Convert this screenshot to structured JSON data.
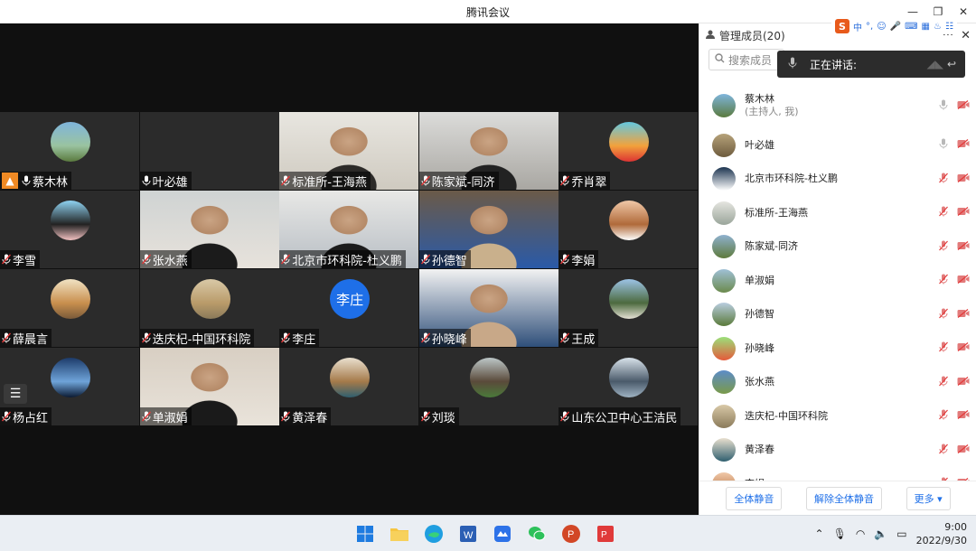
{
  "window": {
    "title": "腾讯会议"
  },
  "ime": {
    "logo": "S",
    "mode": "中"
  },
  "tiles": [
    {
      "name": "蔡木林",
      "host": true,
      "muted": false,
      "kind": "avatar",
      "palette": [
        "#7fb5dc",
        "#9ac3a0",
        "#5a7a3e"
      ]
    },
    {
      "name": "叶必雄",
      "muted": false,
      "kind": "blank"
    },
    {
      "name": "标准所-王海燕",
      "muted": true,
      "kind": "video",
      "palette": [
        "#e8e6e0",
        "#cfcac0",
        "#2c2a28"
      ]
    },
    {
      "name": "陈家斌-同济",
      "muted": true,
      "kind": "video",
      "palette": [
        "#dcdcda",
        "#a9a7a2",
        "#222"
      ]
    },
    {
      "name": "乔肖翠",
      "muted": true,
      "kind": "avatar",
      "palette": [
        "#63c8e0",
        "#f2a23c",
        "#d33"
      ]
    },
    {
      "name": "李雪",
      "muted": true,
      "kind": "avatar",
      "palette": [
        "#8fd3f2",
        "#222",
        "#f3c2c2"
      ]
    },
    {
      "name": "张水燕",
      "muted": true,
      "kind": "video",
      "palette": [
        "#cfd3d3",
        "#e7e2db",
        "#1b1b1b"
      ]
    },
    {
      "name": "北京市环科院-杜义鹏",
      "muted": true,
      "kind": "video",
      "palette": [
        "#e8e8e6",
        "#b8bec4",
        "#1c1c1c"
      ]
    },
    {
      "name": "孙德智",
      "muted": true,
      "kind": "video",
      "palette": [
        "#6b5a48",
        "#2a5aa8",
        "#c9b08c"
      ]
    },
    {
      "name": "李娟",
      "muted": true,
      "kind": "avatar",
      "palette": [
        "#f0c8a8",
        "#b06a3a",
        "#fff"
      ]
    },
    {
      "name": "薛晨言",
      "muted": true,
      "kind": "avatar",
      "palette": [
        "#f1e3c4",
        "#c98f4e",
        "#7a5a3a"
      ]
    },
    {
      "name": "迭庆杞-中国环科院",
      "muted": true,
      "kind": "avatar",
      "palette": [
        "#d9c9a7",
        "#b99b6a",
        "#8a7a5a"
      ]
    },
    {
      "name": "李庄",
      "muted": true,
      "kind": "letter",
      "letter": "李庄"
    },
    {
      "name": "孙晓峰",
      "muted": true,
      "kind": "video",
      "palette": [
        "#f2f2f2",
        "#2f4f7a",
        "#c8a888"
      ]
    },
    {
      "name": "王成",
      "muted": true,
      "kind": "avatar",
      "palette": [
        "#9cc3e6",
        "#4c6a3e",
        "#e5e1d5"
      ]
    },
    {
      "name": "杨占红",
      "muted": true,
      "kind": "avatar",
      "palette": [
        "#1d3b6a",
        "#6fa4d9",
        "#0b1a33"
      ]
    },
    {
      "name": "单淑娟",
      "muted": true,
      "kind": "video",
      "palette": [
        "#d8cfc3",
        "#e9e3da",
        "#1a1a1a"
      ]
    },
    {
      "name": "黄泽春",
      "muted": true,
      "kind": "avatar",
      "palette": [
        "#e9e0cf",
        "#a57a4a",
        "#2f5f6f"
      ]
    },
    {
      "name": "刘琰",
      "muted": true,
      "kind": "avatar",
      "palette": [
        "#bcc7c8",
        "#5a4a3a",
        "#4a7a3a"
      ]
    },
    {
      "name": "山东公卫中心王洁民",
      "muted": true,
      "kind": "avatar",
      "palette": [
        "#d8e2ea",
        "#4a5a6a",
        "#9fb3c2"
      ]
    }
  ],
  "panel": {
    "title": "管理成员(20)",
    "search_placeholder": "搜索成员",
    "speaking_label": "正在讲话:",
    "members": [
      {
        "name": "蔡木林",
        "sub": "(主持人, 我)",
        "muted": false,
        "palette": [
          "#7fb5dc",
          "#5a7a3e"
        ]
      },
      {
        "name": "叶必雄",
        "muted": false,
        "palette": [
          "#b6a27a",
          "#6d5b3d"
        ]
      },
      {
        "name": "北京市环科院-杜义鹏",
        "muted": true,
        "palette": [
          "#1c3450",
          "#ffffff"
        ]
      },
      {
        "name": "标准所-王海燕",
        "muted": true,
        "palette": [
          "#e5e5e0",
          "#9aa59a"
        ]
      },
      {
        "name": "陈家斌-同济",
        "muted": true,
        "palette": [
          "#8fb1cf",
          "#5e7a3c"
        ]
      },
      {
        "name": "单淑娟",
        "muted": true,
        "palette": [
          "#9fc0d6",
          "#6b8a4d"
        ]
      },
      {
        "name": "孙德智",
        "muted": true,
        "palette": [
          "#b9cde0",
          "#5a7a3a"
        ]
      },
      {
        "name": "孙晓峰",
        "muted": true,
        "palette": [
          "#9be07a",
          "#e55a3a"
        ]
      },
      {
        "name": "张水燕",
        "muted": true,
        "palette": [
          "#5c8cc8",
          "#7a9a4a"
        ]
      },
      {
        "name": "迭庆杞-中国环科院",
        "muted": true,
        "palette": [
          "#d9c9a7",
          "#8a7a5a"
        ]
      },
      {
        "name": "黄泽春",
        "muted": true,
        "palette": [
          "#e9e0cf",
          "#2f5f6f"
        ]
      },
      {
        "name": "李娟",
        "muted": true,
        "palette": [
          "#f0c8a8",
          "#b06a3a"
        ]
      }
    ],
    "footer": {
      "mute_all": "全体静音",
      "unmute_all": "解除全体静音",
      "more": "更多"
    }
  },
  "taskbar": {
    "time": "9:00",
    "date": "2022/9/30"
  }
}
